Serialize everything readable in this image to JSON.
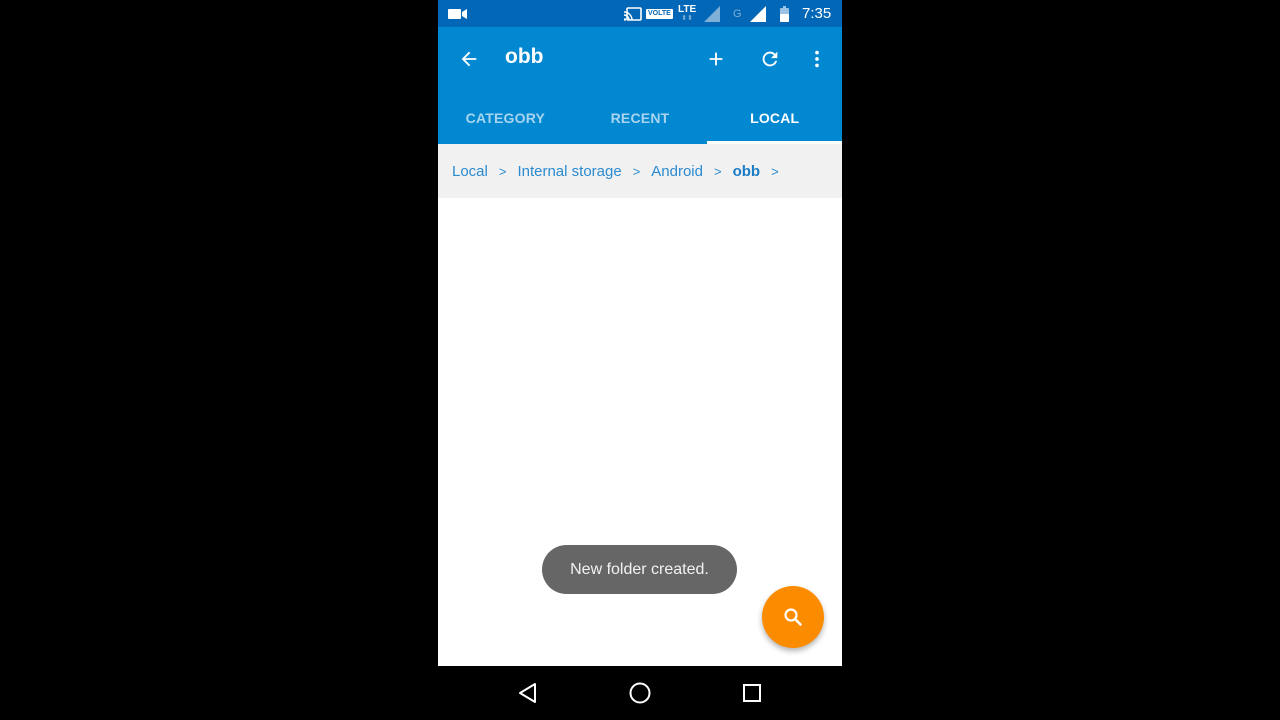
{
  "status_bar": {
    "icons": [
      "video-camera-icon",
      "cast-icon",
      "volte-icon",
      "lte-icon",
      "signal-icon",
      "network-g-icon",
      "signal-icon",
      "battery-icon"
    ],
    "volte_label": "VOLTE",
    "lte_label": "LTE",
    "lte_sub": "⬍⬍",
    "network_label": "G",
    "time": "7:35"
  },
  "app_bar": {
    "title": "obb",
    "back_icon": "arrow-left-icon",
    "actions": [
      "add-icon",
      "refresh-icon",
      "more-vert-icon"
    ]
  },
  "tabs": [
    {
      "label": "CATEGORY",
      "active": false
    },
    {
      "label": "RECENT",
      "active": false
    },
    {
      "label": "LOCAL",
      "active": true
    }
  ],
  "breadcrumb": {
    "items": [
      "Local",
      "Internal storage",
      "Android",
      "obb"
    ],
    "separator": ">"
  },
  "toast": {
    "message": "New folder created."
  },
  "fab": {
    "icon": "search-icon"
  },
  "colors": {
    "status_bar": "#0267b6",
    "primary": "#0288d1",
    "accent": "#fb8c00",
    "breadcrumb_text": "#2a8bd0",
    "toast_bg": "#666666"
  }
}
